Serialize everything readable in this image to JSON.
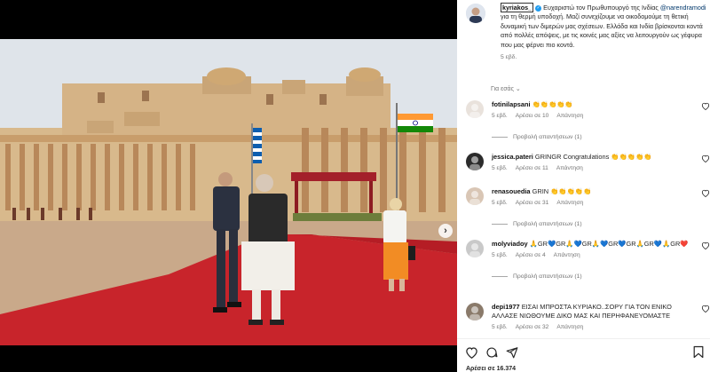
{
  "post": {
    "username": "kyriakos_",
    "caption_pre": "Ευχαριστώ τον Πρωθυπουργό της Ινδίας ",
    "mention": "@narendramodi",
    "caption_post": " για τη θερμή υποδοχή. Μαζί συνεχίζουμε να οικοδομούμε τη θετική δυναμική των διμερών μας σχέσεων. Ελλάδα και Ινδία βρίσκονται κοντά από πολλές απόψεις, με τις κοινές μας αξίες να λειτουργούν ως γέφυρα που μας φέρνει πιο κοντά.",
    "time": "5 εβδ.",
    "translate": "Για εσάς",
    "likes": "Αρέσει σε 16.374"
  },
  "carousel": {
    "slides": 9,
    "active_index": 0
  },
  "comments": [
    {
      "user": "fotinilapsani",
      "text": "👏👏👏👏👏",
      "time": "5 εβδ.",
      "likes": "Αρέσει σε 10",
      "reply": "Απάντηση",
      "replies": "Προβολή απαντήσεων (1)",
      "avatar_color": "#e9e2dc"
    },
    {
      "user": "jessica.pateri",
      "text": "GRINGR Congratulations 👏👏👏👏👏",
      "time": "5 εβδ.",
      "likes": "Αρέσει σε 11",
      "reply": "Απάντηση",
      "replies": "",
      "avatar_color": "#2b2b2b"
    },
    {
      "user": "renasouedia",
      "text": "GRIN 👏👏👏👏👏",
      "time": "5 εβδ.",
      "likes": "Αρέσει σε 31",
      "reply": "Απάντηση",
      "replies": "Προβολή απαντήσεων (1)",
      "avatar_color": "#d9c6b5"
    },
    {
      "user": "molyviadoy",
      "text": "🙏GR💙GR🙏💙GR🙏💙GR💙GR🙏GR💙🙏GR❤️",
      "time": "5 εβδ.",
      "likes": "Αρέσει σε 4",
      "reply": "Απάντηση",
      "replies": "Προβολή απαντήσεων (1)",
      "avatar_color": "#c9c9c9"
    },
    {
      "user": "depi1977",
      "text": "ΕΙΣΑΙ ΜΠΡΟΣΤΑ ΚΥΡΙΑΚΟ..ΣΟΡΥ ΓΙΑ ΤΟΝ ΕΝΙΚΟ ΑΛΛΑΣΕ ΝΙΩΘΟΥΜΕ ΔΙΚΟ ΜΑΣ ΚΑΙ ΠΕΡΗΦΑΝΕΥΟΜΑΣΤΕ",
      "time": "5 εβδ.",
      "likes": "Αρέσει σε 32",
      "reply": "Απάντηση",
      "replies": "",
      "avatar_color": "#8a7a6a"
    }
  ],
  "colors": {
    "accent": "#2f80ed",
    "carpet": "#c8242b",
    "sandstone": "#d9b98a",
    "verified": "#1d9bf0"
  },
  "icons": [
    "chevron-right-icon",
    "heart-icon",
    "comment-icon",
    "share-icon",
    "bookmark-icon",
    "verified-icon"
  ]
}
